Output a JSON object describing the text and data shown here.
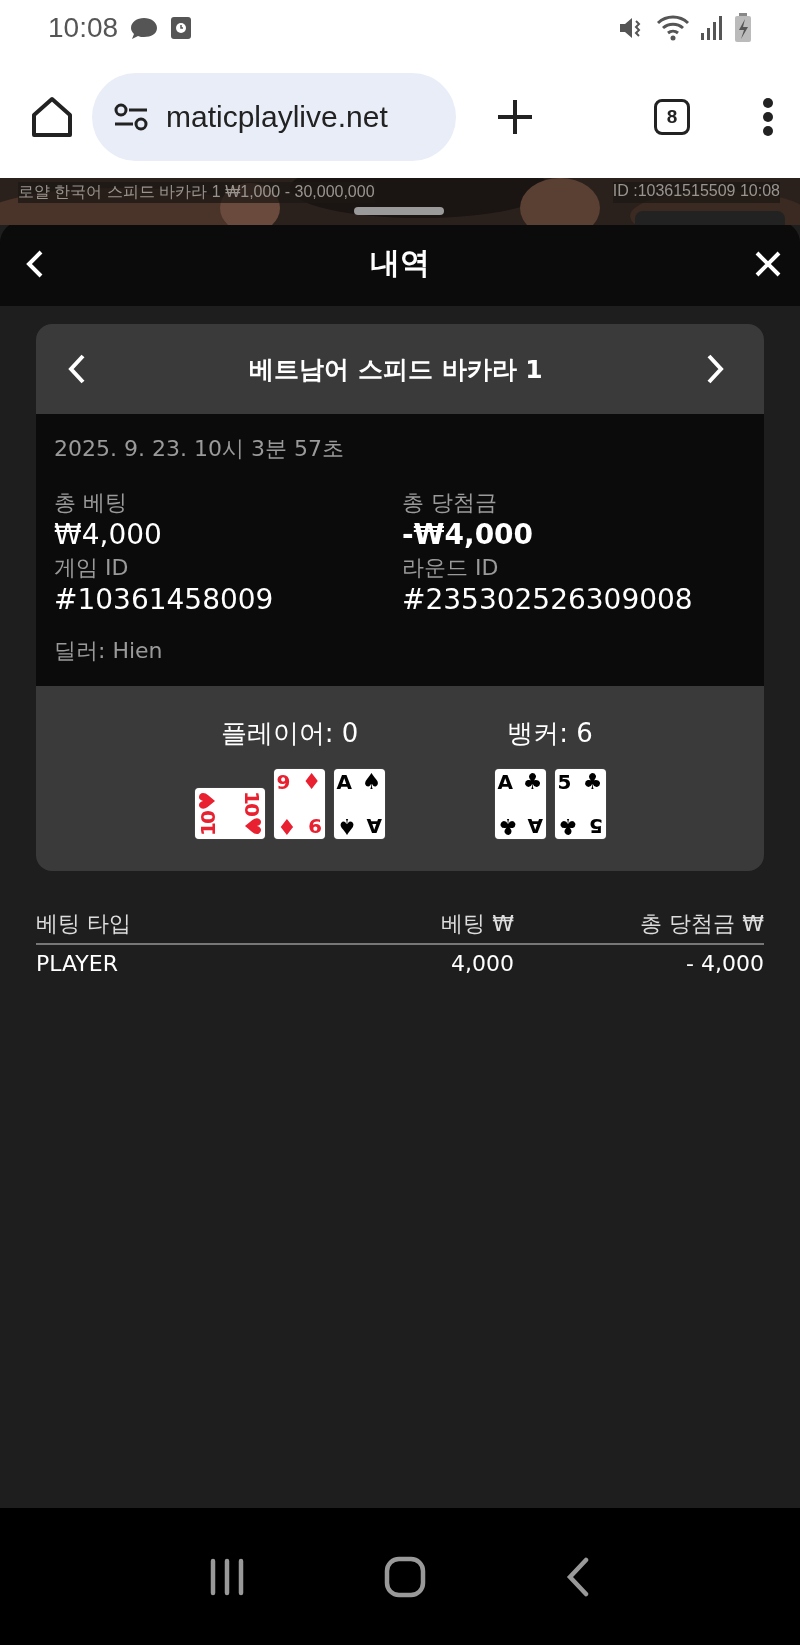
{
  "status_bar": {
    "time": "10:08"
  },
  "browser": {
    "url": "maticplaylive.net",
    "tab_count": "8"
  },
  "video_strip": {
    "kind": "picture",
    "table_info": "로얄 한국어 스피드 바카라 1 ₩1,000 - 30,000,000",
    "game_id": "ID :10361515509 10:08"
  },
  "sheet": {
    "title": "내역"
  },
  "round": {
    "title": "베트남어 스피드 바카라 1",
    "datetime": "2025. 9. 23. 10시 3분 57초",
    "fields": [
      {
        "label": "총 베팅",
        "value": "₩4,000",
        "bold": false
      },
      {
        "label": "총 당첨금",
        "value": "-₩4,000",
        "bold": true
      },
      {
        "label": "게임 ID",
        "value": "#10361458009",
        "bold": false
      },
      {
        "label": "라운드 ID",
        "value": "#235302526309008",
        "bold": false
      }
    ],
    "dealer": "딜러: Hien",
    "hands": [
      {
        "label": "플레이어: 0",
        "cards": [
          {
            "rotated": true,
            "color": "#e8202f",
            "corners": [
              {
                "rank": "10",
                "suit": "♥"
              },
              {
                "rank": "10",
                "suit": "♥"
              }
            ]
          },
          {
            "rotated": false,
            "color": "#e8202f",
            "corners": [
              {
                "rank": "9",
                "suit": "♦"
              },
              {
                "rank": "9",
                "suit": "♦"
              }
            ]
          },
          {
            "rotated": false,
            "color": "#000000",
            "corners": [
              {
                "rank": "A",
                "suit": "♠"
              },
              {
                "rank": "A",
                "suit": "♠"
              }
            ]
          }
        ]
      },
      {
        "label": "뱅커: 6",
        "cards": [
          {
            "rotated": false,
            "color": "#000000",
            "corners": [
              {
                "rank": "A",
                "suit": "♣"
              },
              {
                "rank": "A",
                "suit": "♣"
              }
            ]
          },
          {
            "rotated": false,
            "color": "#000000",
            "corners": [
              {
                "rank": "5",
                "suit": "♣"
              },
              {
                "rank": "5",
                "suit": "♣"
              }
            ]
          }
        ]
      }
    ]
  },
  "bets_table": {
    "columns": [
      "베팅 타입",
      "베팅 ₩",
      "총 당첨금 ₩"
    ],
    "rows": [
      [
        "PLAYER",
        "4,000",
        "- 4,000"
      ]
    ]
  }
}
